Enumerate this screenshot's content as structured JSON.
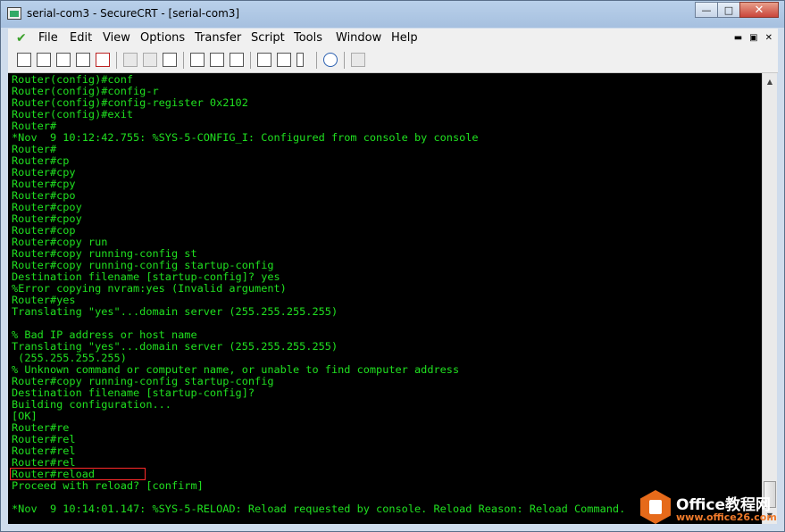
{
  "window": {
    "title": "serial-com3 - SecureCRT - [serial-com3]"
  },
  "caption_buttons": {
    "minimize": "—",
    "maximize": "□",
    "close": "✕"
  },
  "menu": {
    "items": [
      {
        "label": "File"
      },
      {
        "label": "Edit"
      },
      {
        "label": "View"
      },
      {
        "label": "Options"
      },
      {
        "label": "Transfer"
      },
      {
        "label": "Script"
      },
      {
        "label": "Tools"
      },
      {
        "label": "Window"
      },
      {
        "label": "Help"
      }
    ],
    "mdi_buttons": [
      "▬",
      "▣",
      "✕"
    ]
  },
  "toolbar": {
    "icons": [
      "connect-icon",
      "quick-connect-icon",
      "connect-tab-icon",
      "reconnect-icon",
      "disconnect-icon",
      "copy-icon",
      "paste-icon",
      "find-icon",
      "print-icon",
      "print-selection-icon",
      "print-setup-icon",
      "session-options-icon",
      "global-options-icon",
      "keymap-icon",
      "help-icon",
      "sftp-icon"
    ]
  },
  "terminal": {
    "lines": [
      "Router(config)#conf",
      "Router(config)#config-r",
      "Router(config)#config-register 0x2102",
      "Router(config)#exit",
      "Router#",
      "*Nov  9 10:12:42.755: %SYS-5-CONFIG_I: Configured from console by console",
      "Router#",
      "Router#cp",
      "Router#cpy",
      "Router#cpy",
      "Router#cpo",
      "Router#cpoy",
      "Router#cpoy",
      "Router#cop",
      "Router#copy run",
      "Router#copy running-config st",
      "Router#copy running-config startup-config",
      "Destination filename [startup-config]? yes",
      "%Error copying nvram:yes (Invalid argument)",
      "Router#yes",
      "Translating \"yes\"...domain server (255.255.255.255)",
      "",
      "% Bad IP address or host name",
      "Translating \"yes\"...domain server (255.255.255.255)",
      " (255.255.255.255)",
      "% Unknown command or computer name, or unable to find computer address",
      "Router#copy running-config startup-config",
      "Destination filename [startup-config]?",
      "Building configuration...",
      "[OK]",
      "Router#re",
      "Router#rel",
      "Router#rel",
      "Router#rel",
      "Router#reload",
      "Proceed with reload? [confirm]",
      "",
      "*Nov  9 10:14:01.147: %SYS-5-RELOAD: Reload requested by console. Reload Reason: Reload Command."
    ],
    "text_color": "#20e020",
    "background": "#000000",
    "highlight_color": "#ff2a2a"
  },
  "scrollbar": {
    "up": "▲",
    "down": "▼"
  },
  "watermark": {
    "title": "Office教程网",
    "url": "www.office26.com"
  }
}
